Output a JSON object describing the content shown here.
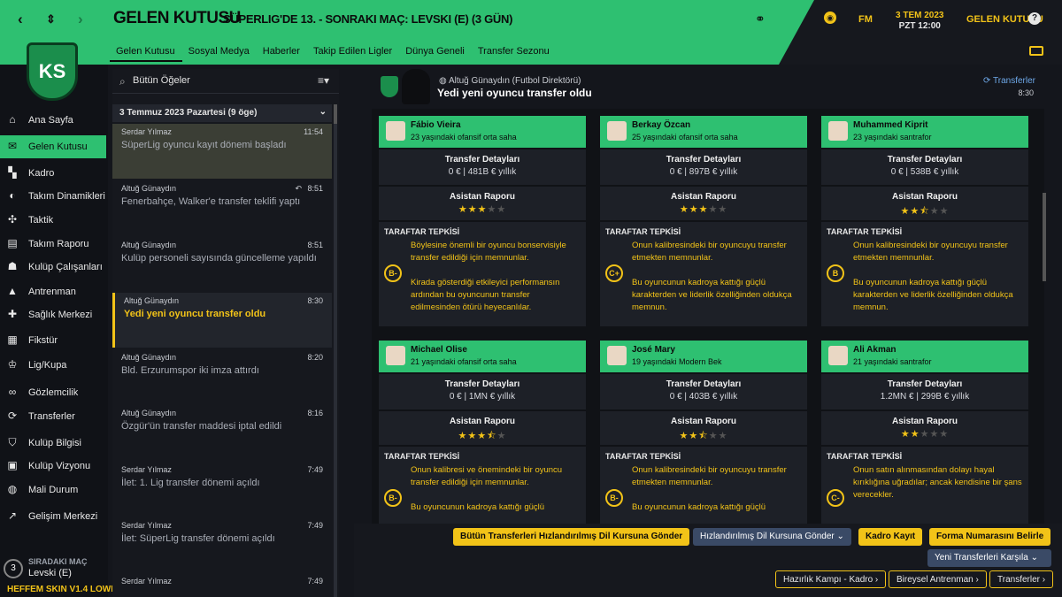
{
  "header": {
    "title": "GELEN KUTUSU",
    "subtitle": "SÜPERLIG'DE 13. - SONRAKI MAÇ: LEVSKI (E) (3 GÜN)",
    "date_line1": "3 TEM 2023",
    "date_line2": "PZT 12:00",
    "fm_label": "FM",
    "inbox_label": "GELEN KUTUSU",
    "help_label": "?",
    "tabs": [
      "Gelen Kutusu",
      "Sosyal Medya",
      "Haberler",
      "Takip Edilen Ligler",
      "Dünya Geneli",
      "Transfer Sezonu"
    ]
  },
  "club_badge": "KS",
  "nav": {
    "items": [
      {
        "label": "Ana Sayfa",
        "icon": "home-icon"
      },
      {
        "label": "Gelen Kutusu",
        "icon": "mail-icon"
      },
      {
        "label": "Kadro",
        "icon": "shirt-icon"
      },
      {
        "label": "Takım Dinamikleri",
        "icon": "brain-icon"
      },
      {
        "label": "Taktik",
        "icon": "tactics-icon"
      },
      {
        "label": "Takım Raporu",
        "icon": "report-icon"
      },
      {
        "label": "Kulüp Çalışanları",
        "icon": "staff-icon"
      },
      {
        "label": "Antrenman",
        "icon": "cone-icon"
      },
      {
        "label": "Sağlık Merkezi",
        "icon": "medical-icon"
      },
      {
        "label": "Fikstür",
        "icon": "calendar-icon"
      },
      {
        "label": "Lig/Kupa",
        "icon": "trophy-icon"
      },
      {
        "label": "Gözlemcilik",
        "icon": "binoculars-icon"
      },
      {
        "label": "Transferler",
        "icon": "transfer-icon"
      },
      {
        "label": "Kulüp Bilgisi",
        "icon": "shield-icon"
      },
      {
        "label": "Kulüp Vizyonu",
        "icon": "briefcase-icon"
      },
      {
        "label": "Mali Durum",
        "icon": "money-icon"
      },
      {
        "label": "Gelişim Merkezi",
        "icon": "growth-icon"
      }
    ],
    "next_match_label": "SIRADAKI MAÇ",
    "next_match_num": "3",
    "next_match_team": "Levski (E)",
    "skin_label": "HEFFEM SKIN V1.4 LOWRES"
  },
  "inbox": {
    "filter_label": "Bütün Öğeler",
    "group_label": "3 Temmuz 2023 Pazartesi (9 öge)",
    "messages": [
      {
        "sender": "Serdar Yılmaz",
        "time": "11:54",
        "subject": "SüperLig oyuncu kayıt dönemi başladı"
      },
      {
        "sender": "Altuğ Günaydın",
        "time": "8:51",
        "subject": "Fenerbahçe, Walker'e transfer teklifi yaptı"
      },
      {
        "sender": "Altuğ Günaydın",
        "time": "8:51",
        "subject": "Kulüp personeli sayısında güncelleme yapıldı"
      },
      {
        "sender": "Altuğ Günaydın",
        "time": "8:30",
        "subject": "Yedi yeni oyuncu transfer oldu"
      },
      {
        "sender": "Altuğ Günaydın",
        "time": "8:20",
        "subject": "Bld. Erzurumspor iki imza attırdı"
      },
      {
        "sender": "Altuğ Günaydın",
        "time": "8:16",
        "subject": "Özgür'ün transfer maddesi iptal edildi"
      },
      {
        "sender": "Serdar Yılmaz",
        "time": "7:49",
        "subject": "İlet: 1. Lig transfer dönemi açıldı"
      },
      {
        "sender": "Serdar Yılmaz",
        "time": "7:49",
        "subject": "İlet: SüperLig transfer dönemi açıldı"
      },
      {
        "sender": "Serdar Yılmaz",
        "time": "7:49",
        "subject": ""
      }
    ]
  },
  "message": {
    "from": "Altuğ Günaydın (Futbol Direktörü)",
    "subject": "Yedi yeni oyuncu transfer oldu",
    "category": "Transferler",
    "time": "8:30",
    "labels": {
      "transfer_details": "Transfer Detayları",
      "assistant_report": "Asistan Raporu",
      "fan_reaction": "TARAFTAR TEPKİSİ"
    },
    "players": [
      {
        "name": "Fábio Vieira",
        "desc": "23 yaşındaki ofansif orta saha",
        "fee": "0 € | 481B € yıllık",
        "stars": 3,
        "grade": "B-",
        "p1": "Böylesine önemli bir oyuncu bonservisiyle transfer edildiği için memnunlar.",
        "p2": "Kirada gösterdiği etkileyici performansın ardından bu oyuncunun transfer edilmesinden ötürü heyecanlılar."
      },
      {
        "name": "Berkay Özcan",
        "desc": "25 yaşındaki ofansif orta saha",
        "fee": "0 € | 897B € yıllık",
        "stars": 3,
        "grade": "C+",
        "p1": "Onun kalibresindeki bir oyuncuyu transfer etmekten memnunlar.",
        "p2": "Bu oyuncunun kadroya kattığı güçlü karakterden ve liderlik özelliğinden oldukça memnun."
      },
      {
        "name": "Muhammed Kiprit",
        "desc": "23 yaşındaki santrafor",
        "fee": "0 € | 538B € yıllık",
        "stars": 2.5,
        "grade": "B",
        "p1": "Onun kalibresindeki bir oyuncuyu transfer etmekten memnunlar.",
        "p2": "Bu oyuncunun kadroya kattığı güçlü karakterden ve liderlik özelliğinden oldukça memnun."
      },
      {
        "name": "Michael Olise",
        "desc": "21 yaşındaki ofansif orta saha",
        "fee": "0 € | 1MN € yıllık",
        "stars": 3.5,
        "grade": "B-",
        "p1": "Onun kalibresi ve önemindeki bir oyuncu transfer edildiği için memnunlar.",
        "p2": "Bu oyuncunun kadroya kattığı güçlü"
      },
      {
        "name": "José Mary",
        "desc": "19 yaşındaki Modern Bek",
        "fee": "0 € | 403B € yıllık",
        "stars": 2.5,
        "grade": "B-",
        "p1": "Onun kalibresindeki bir oyuncuyu transfer etmekten memnunlar.",
        "p2": "Bu oyuncunun kadroya kattığı güçlü"
      },
      {
        "name": "Ali Akman",
        "desc": "21 yaşındaki santrafor",
        "fee": "1.2MN € | 299B € yıllık",
        "stars": 2,
        "grade": "C-",
        "p1": "Onun satın alınmasından dolayı hayal kırıklığına uğradılar; ancak kendisine bir şans verecekler.",
        "p2": ""
      }
    ]
  },
  "footer": {
    "btn_send_all": "Bütün Transferleri Hızlandırılmış Dil Kursuna Gönder",
    "btn_send_course": "Hızlandırılmış Dil Kursuna Gönder",
    "btn_register": "Kadro Kayıt",
    "btn_shirt": "Forma Numarasını Belirle",
    "btn_welcome": "Yeni Transferleri Karşıla",
    "btn_camp": "Hazırlık Kampı - Kadro",
    "btn_training": "Bireysel Antrenman",
    "btn_transfers": "Transferler"
  },
  "colors": {
    "accent_green": "#2ec071",
    "accent_yellow": "#f2c318",
    "background": "#14161c"
  }
}
